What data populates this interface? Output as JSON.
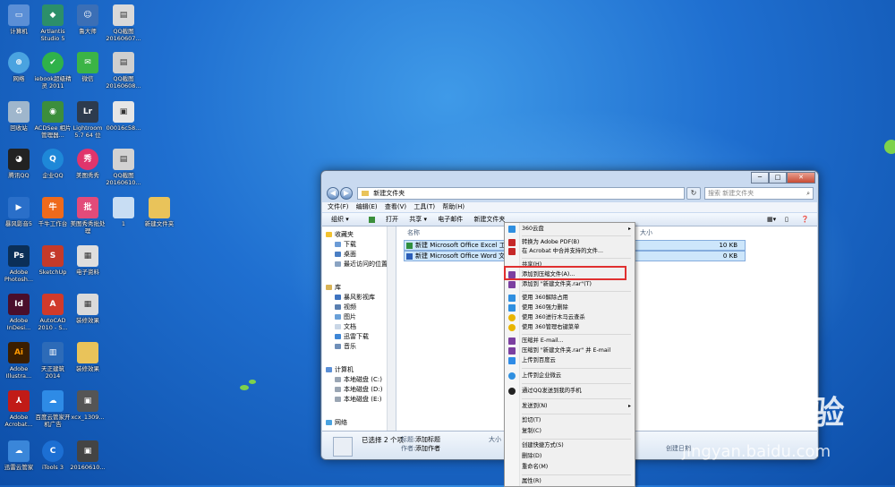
{
  "desktop": {
    "icons": [
      {
        "label": "计算机",
        "icon": "computer-icon",
        "color": "#5b8fd6"
      },
      {
        "label": "Artlantis Studio 5",
        "icon": "artlantis-icon",
        "color": "#2c8f6a"
      },
      {
        "label": "鲁大师",
        "icon": "ludashi-icon",
        "color": "#3b6fb6"
      },
      {
        "label": "QQ截图 20160607...",
        "icon": "screenshot-icon",
        "color": "#d9d9d9"
      },
      {
        "label": "网络",
        "icon": "network-icon",
        "color": "#4aa3e0"
      },
      {
        "label": "iebook超级精灵 2011",
        "icon": "iebook-icon",
        "color": "#2fb24a"
      },
      {
        "label": "微信",
        "icon": "wechat-icon",
        "color": "#3bb446"
      },
      {
        "label": "QQ截图 20160608...",
        "icon": "screenshot-icon",
        "color": "#cfcfcf"
      },
      {
        "label": "回收站",
        "icon": "recycle-bin-icon",
        "color": "#9fb6cc"
      },
      {
        "label": "ACDSee 相片管理器...",
        "icon": "acdsee-icon",
        "color": "#3c8e3c"
      },
      {
        "label": "Lightroom 5.7 64 位",
        "icon": "lightroom-icon",
        "color": "#2d3b4e"
      },
      {
        "label": "00016c58...",
        "icon": "image-file-icon",
        "color": "#e6e6e6"
      },
      {
        "label": "腾讯QQ",
        "icon": "qq-icon",
        "color": "#222222"
      },
      {
        "label": "企业QQ",
        "icon": "enterprise-qq-icon",
        "color": "#1e88d8"
      },
      {
        "label": "美图秀秀",
        "icon": "meitu-icon",
        "color": "#e0356c"
      },
      {
        "label": "QQ截图 20160610...",
        "icon": "screenshot-icon",
        "color": "#d2d2d2"
      },
      {
        "label": "暴风影音5",
        "icon": "baofeng-icon",
        "color": "#2a6fc9"
      },
      {
        "label": "千牛工作台",
        "icon": "qianniu-icon",
        "color": "#ee6a1c"
      },
      {
        "label": "美图秀秀批处理",
        "icon": "meitu-batch-icon",
        "color": "#e24b7a"
      },
      {
        "label": "1",
        "icon": "folder-icon",
        "color": "#c8ddf3"
      },
      {
        "label": "新建文件夹",
        "icon": "folder-icon",
        "color": "#e9c35a"
      },
      {
        "label": "Adobe Photosh...",
        "icon": "photoshop-icon",
        "color": "#0b2f57"
      },
      {
        "label": "SketchUp",
        "icon": "sketchup-icon",
        "color": "#c43a2a"
      },
      {
        "label": "电子资料",
        "icon": "shortcut-icon",
        "color": "#dedede"
      },
      {
        "label": "Adobe InDesi...",
        "icon": "indesign-icon",
        "color": "#4a0e2b"
      },
      {
        "label": "AutoCAD 2010 - S...",
        "icon": "autocad-icon",
        "color": "#d03a2b"
      },
      {
        "label": "装修效果",
        "icon": "shortcut-icon",
        "color": "#dadada"
      },
      {
        "label": "Adobe Illustra...",
        "icon": "illustrator-icon",
        "color": "#3a1e00"
      },
      {
        "label": "天正建筑 2014",
        "icon": "tangent-icon",
        "color": "#2d6bb8"
      },
      {
        "label": "装修效果",
        "icon": "folder-icon",
        "color": "#e9c35a"
      },
      {
        "label": "Adobe Acrobat...",
        "icon": "acrobat-icon",
        "color": "#c11b17"
      },
      {
        "label": "百度云管家开机广告",
        "icon": "baidu-pan-icon",
        "color": "#2e8be6"
      },
      {
        "label": "xcx_1309...",
        "icon": "image-file-icon",
        "color": "#555555"
      },
      {
        "label": "迅雷云管家",
        "icon": "cloud-icon",
        "color": "#3a86d9"
      },
      {
        "label": "iTools 3",
        "icon": "itools-icon",
        "color": "#1c6fd3"
      },
      {
        "label": "20160610...",
        "icon": "image-file-icon",
        "color": "#444444"
      }
    ]
  },
  "window": {
    "title": "新建文件夹",
    "address": "新建文件夹",
    "search_placeholder": "搜索 新建文件夹",
    "menu": [
      "文件(F)",
      "编辑(E)",
      "查看(V)",
      "工具(T)",
      "帮助(H)"
    ],
    "toolbar": [
      "组织 ▾",
      "打开",
      "共享 ▾",
      "电子邮件",
      "新建文件夹"
    ],
    "nav": {
      "favorites_label": "收藏夹",
      "favorites": [
        "下载",
        "桌面",
        "最近访问的位置"
      ],
      "library_label": "库",
      "library": [
        "暴风影视库",
        "视频",
        "图片",
        "文档",
        "迅雷下载",
        "音乐"
      ],
      "computer_label": "计算机",
      "computer": [
        "本地磁盘 (C:)",
        "本地磁盘 (D:)",
        "本地磁盘 (E:)"
      ],
      "network_label": "网络"
    },
    "columns": {
      "name": "名称",
      "size": "大小"
    },
    "files": [
      {
        "name": "新建 Microsoft Office Excel 工作表",
        "size": "10 KB"
      },
      {
        "name": "新建 Microsoft Office Word 文档",
        "size": "0 KB"
      }
    ],
    "status": {
      "selected": "已选择 2 个项",
      "title_label": "标题:",
      "title_value": "添加标题",
      "author_label": "作者:",
      "author_value": "添加作者",
      "size_label": "大小",
      "date_label": "创建日期"
    }
  },
  "context_menu": {
    "items": [
      {
        "label": "360云盘",
        "icon": "cloud-360-icon",
        "color": "#2f8fe0",
        "arrow": "▸"
      },
      {
        "label": "转换为 Adobe PDF(B)",
        "icon": "pdf-icon",
        "color": "#c62828"
      },
      {
        "label": "在 Acrobat 中合并支持的文件...",
        "icon": "acrobat-merge-icon",
        "color": "#c62828"
      },
      {
        "label": "共享(H)",
        "icon": "",
        "color": ""
      },
      {
        "label": "添加到压缩文件(A)...",
        "icon": "winrar-icon",
        "color": "#7b3fa0"
      },
      {
        "label": "添加到 \"新建文件夹.rar\"(T)",
        "icon": "winrar-icon",
        "color": "#7b3fa0"
      },
      {
        "label": "使用 360解除占用",
        "icon": "shield-360-icon",
        "color": "#2f8fe0"
      },
      {
        "label": "使用 360强力删除",
        "icon": "shield-360-icon",
        "color": "#2f8fe0"
      },
      {
        "label": "使用 360进行木马云查杀",
        "icon": "shield-360-yellow-icon",
        "color": "#e8b400"
      },
      {
        "label": "使用 360管理右键菜单",
        "icon": "shield-360-yellow-icon",
        "color": "#e8b400"
      },
      {
        "label": "压缩并 E-mail...",
        "icon": "winrar-icon",
        "color": "#7b3fa0"
      },
      {
        "label": "压缩到 \"新建文件夹.rar\" 并 E-mail",
        "icon": "winrar-icon",
        "color": "#7b3fa0"
      },
      {
        "label": "上传到百度云",
        "icon": "baidu-cloud-icon",
        "color": "#2e8be6"
      },
      {
        "label": "上传到企业微云",
        "icon": "weiyun-icon",
        "color": "#2f8fe0"
      },
      {
        "label": "通过QQ发送到我的手机",
        "icon": "qq-icon",
        "color": "#222222"
      },
      {
        "label": "发送到(N)",
        "icon": "",
        "color": "",
        "arrow": "▸"
      },
      {
        "label": "剪切(T)",
        "icon": "",
        "color": ""
      },
      {
        "label": "复制(C)",
        "icon": "",
        "color": ""
      },
      {
        "label": "创建快捷方式(S)",
        "icon": "",
        "color": ""
      },
      {
        "label": "删除(D)",
        "icon": "",
        "color": ""
      },
      {
        "label": "重命名(M)",
        "icon": "",
        "color": ""
      },
      {
        "label": "属性(R)",
        "icon": "",
        "color": ""
      }
    ]
  },
  "watermark": {
    "logo": "Baidu经验",
    "url": "jingyan.baidu.com"
  }
}
